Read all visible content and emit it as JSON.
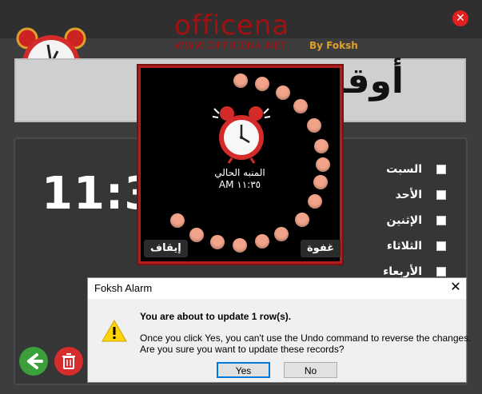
{
  "app": {
    "logo": "officena",
    "tagline": "WWW.OFFICENA.NET",
    "byline": "By Foksh",
    "close_icon": "close-icon",
    "header_title": "أوقات المعالجة",
    "time_display": "11:35",
    "days": [
      "السبت",
      "الأحد",
      "الإثنين",
      "الثلاثاء",
      "الأربعاء"
    ],
    "back_icon": "arrow-left-icon",
    "delete_icon": "trash-icon"
  },
  "popup": {
    "current_label": "المنبه الحالي",
    "current_time": "AM ١١:٣٥",
    "stop_label": "إيقاف",
    "snooze_label": "غفوة"
  },
  "dialog": {
    "title": "Foksh Alarm",
    "headline": "You are about to update 1 row(s).",
    "body_line1": "Once you click Yes, you can't use the Undo command to reverse the changes.",
    "body_line2": "Are you sure you want to update these records?",
    "yes_label": "Yes",
    "no_label": "No",
    "warning_icon": "warning-icon",
    "close_icon": "close-icon"
  },
  "colors": {
    "brand": "#a40f0f",
    "accent": "#e0a12a",
    "popup_border": "#b21e1e",
    "dot": "#f2a48a"
  }
}
